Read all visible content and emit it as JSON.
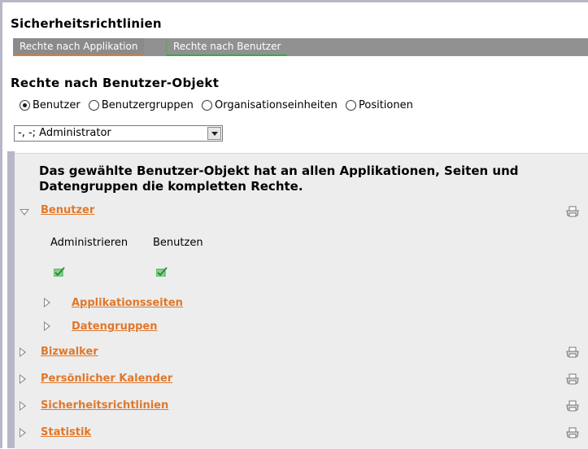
{
  "page_title": "Sicherheitsrichtlinien",
  "tabs": [
    {
      "label": "Rechte nach Applikation",
      "active": true
    },
    {
      "label": "Rechte nach Benutzer",
      "active": false
    }
  ],
  "section_title": "Rechte nach Benutzer-Objekt",
  "radio_options": [
    {
      "label": "Benutzer",
      "selected": true
    },
    {
      "label": "Benutzergruppen",
      "selected": false
    },
    {
      "label": "Organisationseinheiten",
      "selected": false
    },
    {
      "label": "Positionen",
      "selected": false
    }
  ],
  "user_select": {
    "value": "-, -; Administrator"
  },
  "info_text": "Das gewählte Benutzer-Objekt hat an allen Applikationen, Seiten und Datengruppen die kompletten Rechte.",
  "tree": {
    "expanded_item": {
      "label": "Benutzer",
      "expanded": true
    },
    "permission_columns": [
      "Administrieren",
      "Benutzen"
    ],
    "permission_values": [
      true,
      true
    ],
    "children": [
      {
        "label": "Applikationsseiten",
        "expanded": false
      },
      {
        "label": "Datengruppen",
        "expanded": false
      }
    ],
    "items": [
      {
        "label": "Bizwalker",
        "expanded": false
      },
      {
        "label": "Persönlicher Kalender",
        "expanded": false
      },
      {
        "label": "Sicherheitsrichtlinien",
        "expanded": false
      },
      {
        "label": "Statistik",
        "expanded": false
      }
    ]
  },
  "colors": {
    "link": "#e0782a",
    "tabbar": "#919191",
    "panel": "#ededed",
    "check": "#3aa84b"
  },
  "icons": {
    "print": "printer-icon",
    "expand": "triangle-right-icon",
    "collapse": "triangle-down-icon"
  }
}
